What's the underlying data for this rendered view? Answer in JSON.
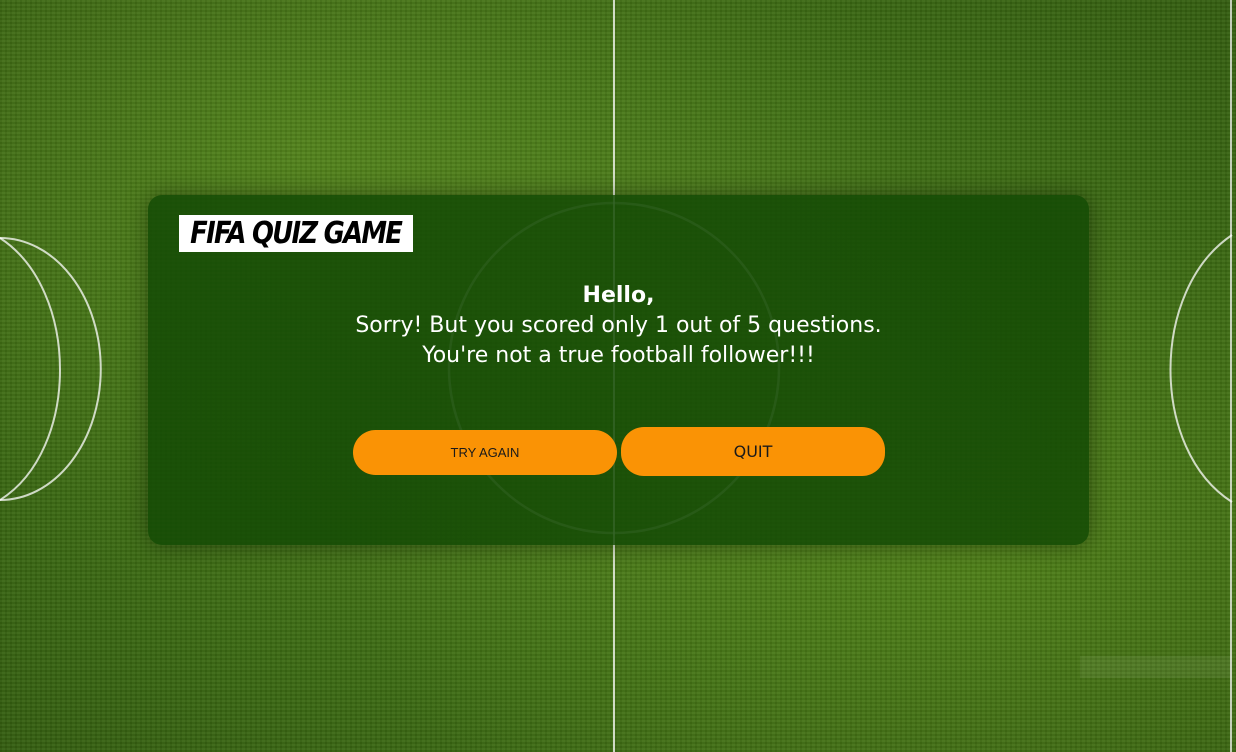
{
  "logo": {
    "text": "FIFA QUIZ GAME"
  },
  "result": {
    "greeting": "Hello,",
    "score_line": "Sorry! But you scored only 1 out of 5 questions.",
    "verdict_line": "You're not a true football follower!!!"
  },
  "buttons": {
    "try_again": "TRY AGAIN",
    "quit": "QUIT"
  },
  "colors": {
    "modal_bg": "#144b05",
    "button_bg": "#fa9305",
    "pitch_green": "#3e6e14",
    "line_white": "#ffffff"
  }
}
